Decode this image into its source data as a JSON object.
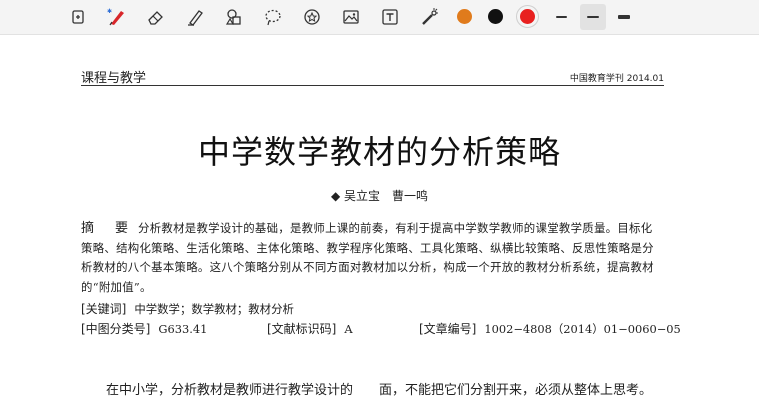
{
  "toolbar": {
    "tools": [
      {
        "name": "insert-icon"
      },
      {
        "name": "pen-icon"
      },
      {
        "name": "eraser-icon"
      },
      {
        "name": "highlighter-icon"
      },
      {
        "name": "shapes-icon"
      },
      {
        "name": "lasso-icon"
      },
      {
        "name": "sticker-icon"
      },
      {
        "name": "image-icon"
      },
      {
        "name": "text-icon"
      },
      {
        "name": "laser-pointer-icon"
      }
    ],
    "colors": [
      "#e07b1c",
      "#111111",
      "#e8201f"
    ],
    "selected_color": "#e8201f"
  },
  "document": {
    "section": "课程与教学",
    "journal": "中国教育学刊 2014.01",
    "title": "中学数学教材的分析策略",
    "authors": "◆ 吴立宝　曹一鸣",
    "abstract_label": "摘　要",
    "abstract_text": "分析教材是教学设计的基础，是教师上课的前奏，有利于提高中学数学教师的课堂教学质量。目标化策略、结构化策略、生活化策略、主体化策略、教学程序化策略、工具化策略、纵横比较策略、反思性策略是分析教材的八个基本策略。这八个策略分别从不同方面对教材加以分析，构成一个开放的教材分析系统，提高教材的“附加值”。",
    "keywords_label": "[关键词]",
    "keywords": "中学数学；数学教材；教材分析",
    "clc_label": "[中图分类号]",
    "clc": "G633.41",
    "doc_code_label": "[文献标识码]",
    "doc_code": "A",
    "article_no_label": "[文章编号]",
    "article_no": "1002−4808（2014）01−0060−05",
    "body_line": "在中小学，分析教材是教师进行教学设计的　　面，不能把它们分割开来，必须从整体上思考。"
  }
}
